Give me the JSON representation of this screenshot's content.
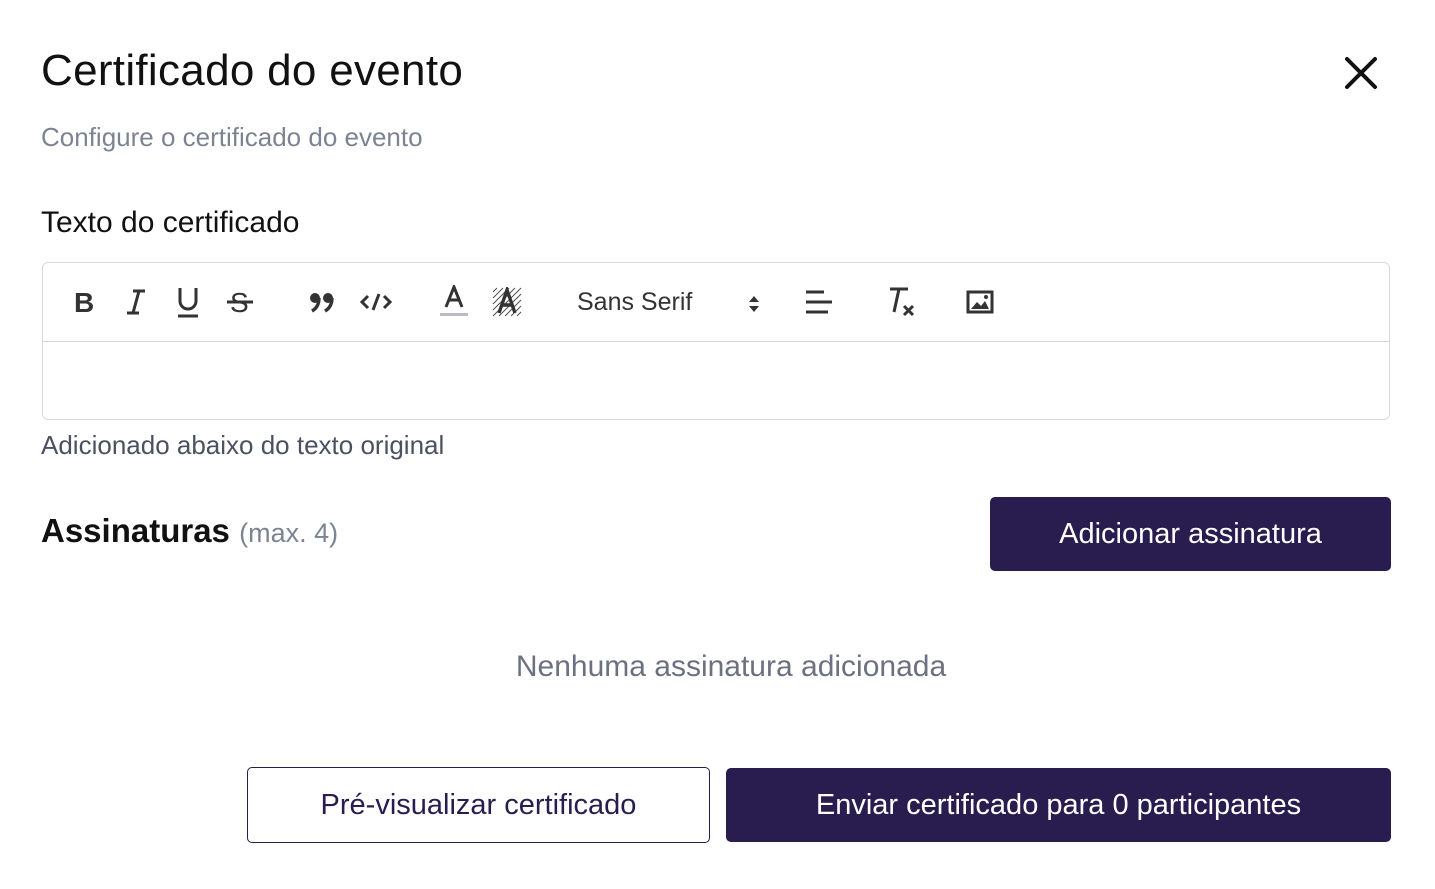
{
  "modal": {
    "title": "Certificado do evento",
    "subtitle": "Configure o certificado do evento"
  },
  "certificate_text": {
    "label": "Texto do certificado",
    "helper": "Adicionado abaixo do texto original",
    "editor_value": "",
    "toolbar": {
      "buttons": [
        "bold-icon",
        "italic-icon",
        "underline-icon",
        "strike-icon",
        "blockquote-icon",
        "code-block-icon",
        "text-color-icon",
        "background-color-icon",
        "align-icon",
        "clear-format-icon",
        "image-icon"
      ],
      "font_select_value": "Sans Serif"
    }
  },
  "signatures": {
    "title": "Assinaturas",
    "max_label": "(max. 4)",
    "add_button": "Adicionar assinatura",
    "empty_message": "Nenhuma assinatura adicionada"
  },
  "footer": {
    "preview_button": "Pré-visualizar certificado",
    "send_button": "Enviar certificado para 0 participantes"
  },
  "colors": {
    "primary": "#291c4e",
    "muted_text": "#7c8493",
    "border": "#d7d9de"
  }
}
